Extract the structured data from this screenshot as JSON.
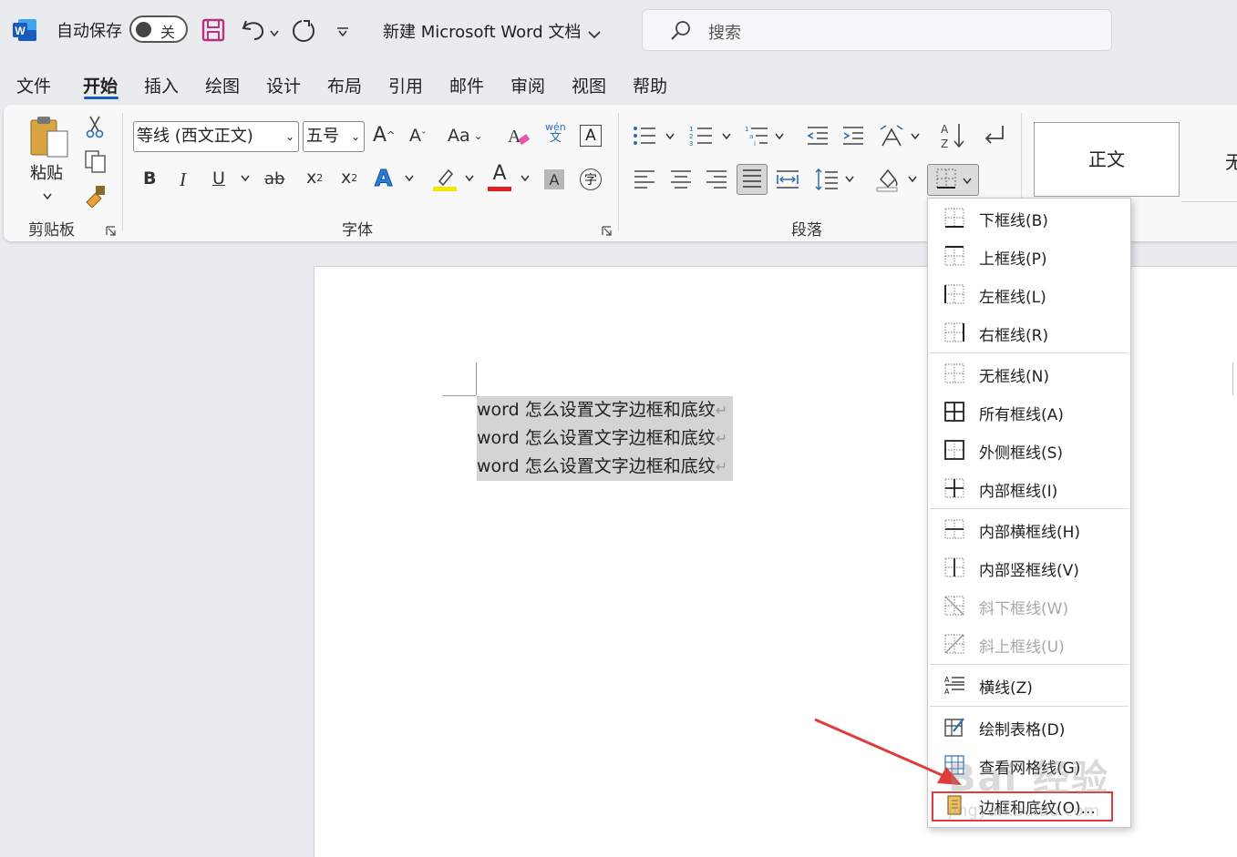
{
  "titlebar": {
    "app_icon": "word-icon",
    "autosave_label": "自动保存",
    "autosave_state": "关",
    "doc_title": "新建 Microsoft Word 文档",
    "search_placeholder": "搜索"
  },
  "tabs": [
    "文件",
    "开始",
    "插入",
    "绘图",
    "设计",
    "布局",
    "引用",
    "邮件",
    "审阅",
    "视图",
    "帮助"
  ],
  "active_tab": "开始",
  "ribbon": {
    "clipboard": {
      "paste_label": "粘贴",
      "group_label": "剪贴板"
    },
    "font": {
      "font_name": "等线 (西文正文)",
      "font_size": "五号",
      "group_label": "字体",
      "case_label": "Aa",
      "phonetic_top": "wén",
      "phonetic_bottom": "文",
      "bold": "B",
      "italic": "I",
      "underline": "U",
      "strike": "ab",
      "subscript": "x",
      "superscript": "x",
      "text_effect": "A",
      "font_color_glyph": "A",
      "char_shading": "A",
      "enclose": "字",
      "highlight_color": "#f7e600",
      "font_color": "#e01f1f"
    },
    "paragraph": {
      "group_label": "段落"
    },
    "styles": {
      "normal": "正文",
      "next": "无"
    }
  },
  "document": {
    "lines": [
      "word 怎么设置文字边框和底纹",
      "word 怎么设置文字边框和底纹",
      "word 怎么设置文字边框和底纹"
    ],
    "para_mark": "↵"
  },
  "menu": {
    "items": [
      {
        "label": "下框线(B)",
        "icon": "border-bottom-icon",
        "disabled": false
      },
      {
        "label": "上框线(P)",
        "icon": "border-top-icon",
        "disabled": false
      },
      {
        "label": "左框线(L)",
        "icon": "border-left-icon",
        "disabled": false
      },
      {
        "label": "右框线(R)",
        "icon": "border-right-icon",
        "disabled": false
      },
      {
        "label": "无框线(N)",
        "icon": "border-none-icon",
        "disabled": false
      },
      {
        "label": "所有框线(A)",
        "icon": "border-all-icon",
        "disabled": false
      },
      {
        "label": "外侧框线(S)",
        "icon": "border-outside-icon",
        "disabled": false
      },
      {
        "label": "内部框线(I)",
        "icon": "border-inside-icon",
        "disabled": false
      },
      {
        "label": "内部横框线(H)",
        "icon": "border-inside-horizontal-icon",
        "disabled": false
      },
      {
        "label": "内部竖框线(V)",
        "icon": "border-inside-vertical-icon",
        "disabled": false
      },
      {
        "label": "斜下框线(W)",
        "icon": "border-diagonal-down-icon",
        "disabled": true
      },
      {
        "label": "斜上框线(U)",
        "icon": "border-diagonal-up-icon",
        "disabled": true
      },
      {
        "label": "横线(Z)",
        "icon": "horizontal-line-icon",
        "disabled": false
      },
      {
        "label": "绘制表格(D)",
        "icon": "draw-table-icon",
        "disabled": false
      },
      {
        "label": "查看网格线(G)",
        "icon": "view-gridlines-icon",
        "disabled": false
      },
      {
        "label": "边框和底纹(O)...",
        "icon": "borders-shading-icon",
        "disabled": false
      }
    ]
  },
  "annotation": {
    "arrow_color": "#e03b3b",
    "highlighted_item": "边框和底纹(O)..."
  },
  "watermark": {
    "text": "Bai 经验",
    "sub": "jingyan.baidu.com"
  }
}
